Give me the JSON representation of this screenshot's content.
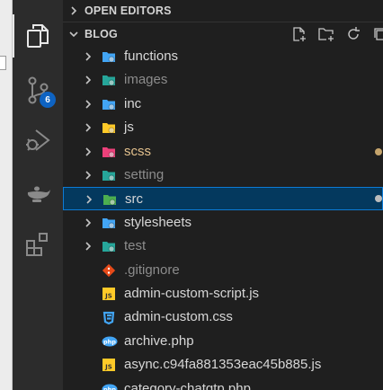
{
  "explorer": {
    "open_editors_title": "OPEN EDITORS",
    "folder_title": "BLOG",
    "items": [
      {
        "label": "functions",
        "kind": "folder",
        "icon": "folder-functions-icon",
        "color": "#42a5f5"
      },
      {
        "label": "images",
        "kind": "folder",
        "icon": "folder-images-icon",
        "color": "#26a69a",
        "dim": true
      },
      {
        "label": "inc",
        "kind": "folder",
        "icon": "folder-inc-icon",
        "color": "#42a5f5"
      },
      {
        "label": "js",
        "kind": "folder",
        "icon": "folder-js-icon",
        "color": "#ffca28"
      },
      {
        "label": "scss",
        "kind": "folder",
        "icon": "folder-scss-icon",
        "color": "#ec407a",
        "modified": true
      },
      {
        "label": "setting",
        "kind": "folder",
        "icon": "folder-setting-icon",
        "color": "#26a69a",
        "dim": true
      },
      {
        "label": "src",
        "kind": "folder",
        "icon": "folder-src-icon",
        "color": "#4caf50",
        "selected": true
      },
      {
        "label": "stylesheets",
        "kind": "folder",
        "icon": "folder-stylesheets-icon",
        "color": "#42a5f5"
      },
      {
        "label": "test",
        "kind": "folder",
        "icon": "folder-test-icon",
        "color": "#26a69a",
        "dim": true
      },
      {
        "label": ".gitignore",
        "kind": "file",
        "icon": "git-icon",
        "color": "#e64a19",
        "dim": true
      },
      {
        "label": "admin-custom-script.js",
        "kind": "file",
        "icon": "js-file-icon",
        "color": "#ffca28"
      },
      {
        "label": "admin-custom.css",
        "kind": "file",
        "icon": "css-file-icon",
        "color": "#42a5f5"
      },
      {
        "label": "archive.php",
        "kind": "file",
        "icon": "php-file-icon",
        "color": "#42a5f5"
      },
      {
        "label": "async.c94fa881353eac45b885.js",
        "kind": "file",
        "icon": "js-file-icon",
        "color": "#ffca28"
      },
      {
        "label": "category-chatgtp.php",
        "kind": "file",
        "icon": "php-file-icon",
        "color": "#42a5f5"
      }
    ]
  },
  "activity_bar": {
    "source_control_badge": "6",
    "icons": [
      "explorer-icon",
      "source-control-icon",
      "run-debug-icon",
      "genie-lamp-icon",
      "extensions-icon"
    ]
  },
  "colors": {
    "selection_bg": "#04395e",
    "selection_border": "#0c7bd6",
    "badge": "#0e63c2"
  }
}
